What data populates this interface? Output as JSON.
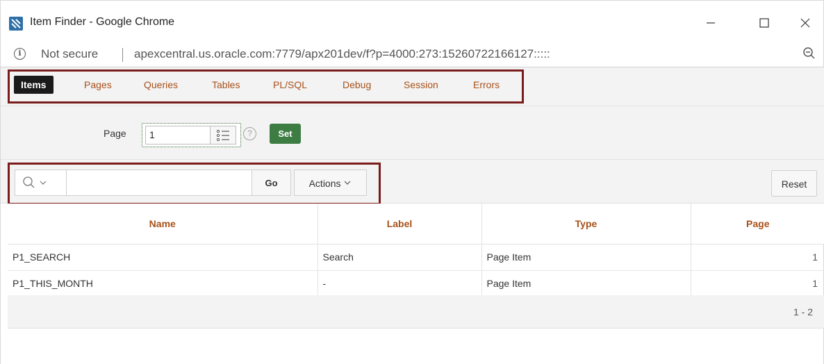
{
  "window": {
    "title": "Item Finder - Google Chrome",
    "app_icon": "apex-x-icon",
    "controls": [
      "minimize-icon",
      "maximize-icon",
      "close-icon"
    ]
  },
  "address_bar": {
    "security_text": "Not secure",
    "url": "apexcentral.us.oracle.com:7779/apx201dev/f?p=4000:273:15260722166127:::::",
    "zoom_icon": "zoom-out-icon"
  },
  "tabs": [
    {
      "label": "Items",
      "active": true
    },
    {
      "label": "Pages",
      "active": false
    },
    {
      "label": "Queries",
      "active": false
    },
    {
      "label": "Tables",
      "active": false
    },
    {
      "label": "PL/SQL",
      "active": false
    },
    {
      "label": "Debug",
      "active": false
    },
    {
      "label": "Session",
      "active": false
    },
    {
      "label": "Errors",
      "active": false
    }
  ],
  "page_filter": {
    "label": "Page",
    "value": "1",
    "help_symbol": "?",
    "set_label": "Set"
  },
  "toolbar": {
    "search_value": "",
    "go_label": "Go",
    "actions_label": "Actions",
    "reset_label": "Reset"
  },
  "report": {
    "columns": [
      "Name",
      "Label",
      "Type",
      "Page"
    ],
    "rows": [
      [
        "P1_SEARCH",
        "Search",
        "Page Item",
        "1"
      ],
      [
        "P1_THIS_MONTH",
        "-",
        "Page Item",
        "1"
      ]
    ],
    "pagination": "1 - 2"
  },
  "colors": {
    "accent": "#a8511a",
    "highlight_border": "#7b1c1c",
    "set_button": "#3d7d44",
    "active_tab": "#1a1a1a"
  }
}
